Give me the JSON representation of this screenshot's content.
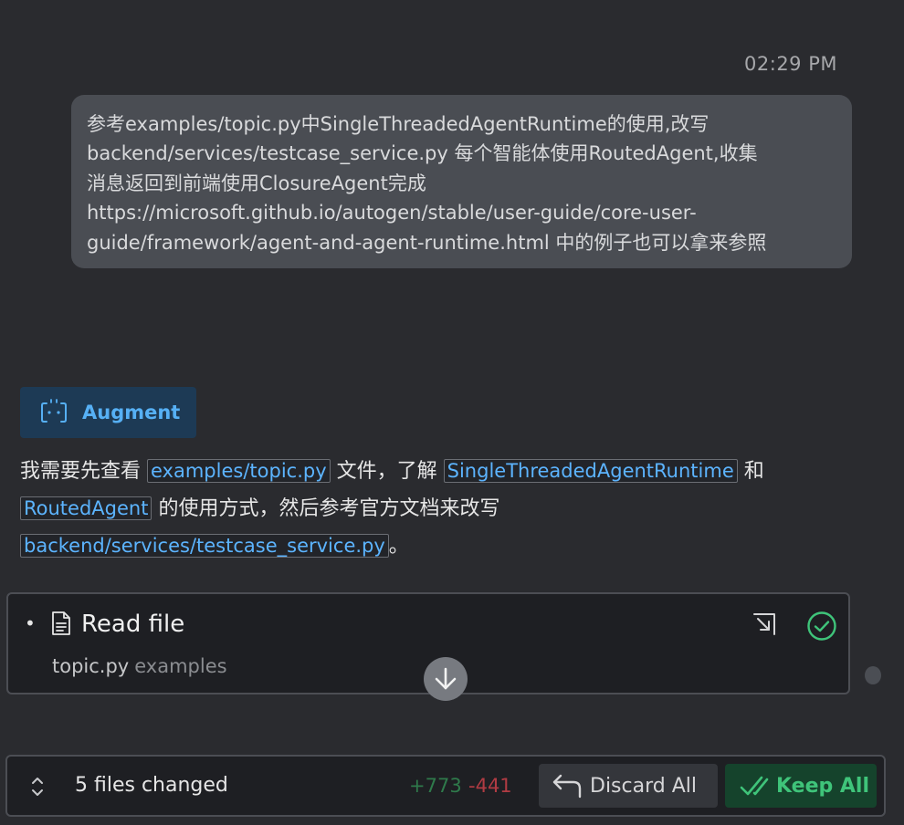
{
  "user_message": {
    "timestamp": "02:29 PM",
    "text": "参考examples/topic.py中SingleThreadedAgentRuntime的使用,改写\nbackend/services/testcase_service.py 每个智能体使用RoutedAgent,收集\n消息返回到前端使用ClosureAgent完成\nhttps://microsoft.github.io/autogen/stable/user-guide/core-user-\nguide/framework/agent-and-agent-runtime.html 中的例子也可以拿来参照"
  },
  "agent": {
    "name": "Augment",
    "icon": "augment-bot-icon",
    "message": {
      "t1": "我需要先查看 ",
      "code1": "examples/topic.py",
      "t2": " 文件，了解 ",
      "code2": "SingleThreadedAgentRuntime",
      "t3": " 和 ",
      "code3": "RoutedAgent",
      "t4": " 的使用方式，然后参考官方文档来改写 ",
      "code4": "backend/services/testcase_service.py",
      "t5": "。"
    }
  },
  "tool_call": {
    "bullet": "•",
    "title": "Read file",
    "file_name": "topic.py",
    "file_dir": "examples",
    "status": "success",
    "icons": [
      "file-icon",
      "open-external-icon",
      "check-circle-icon"
    ]
  },
  "bottom_bar": {
    "files_changed": "5 files changed",
    "additions": "+773",
    "deletions": "-441",
    "discard_label": "Discard All",
    "keep_label": "Keep All"
  },
  "colors": {
    "background": "#2a2b2f",
    "accent_blue": "#56b0f5",
    "success_green": "#3fc47a",
    "deletion_red": "#b03b43"
  }
}
